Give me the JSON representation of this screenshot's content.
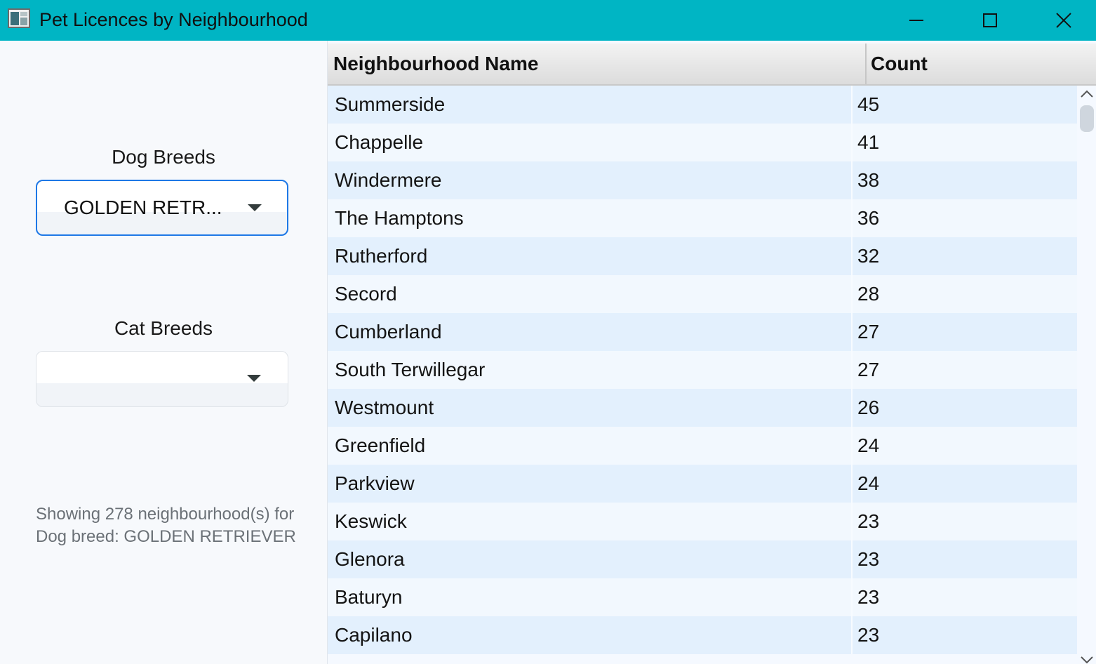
{
  "window": {
    "title": "Pet Licences by Neighbourhood"
  },
  "filters": {
    "dog_label": "Dog Breeds",
    "dog_selected": "GOLDEN RETR...",
    "cat_label": "Cat Breeds",
    "cat_selected": ""
  },
  "status": {
    "text": "Showing 278 neighbourhood(s) for Dog breed: GOLDEN RETRIEVER"
  },
  "table": {
    "columns": [
      "Neighbourhood Name",
      "Count"
    ],
    "rows": [
      {
        "name": "Summerside",
        "count": "45"
      },
      {
        "name": "Chappelle",
        "count": "41"
      },
      {
        "name": "Windermere",
        "count": "38"
      },
      {
        "name": "The Hamptons",
        "count": "36"
      },
      {
        "name": "Rutherford",
        "count": "32"
      },
      {
        "name": "Secord",
        "count": "28"
      },
      {
        "name": "Cumberland",
        "count": "27"
      },
      {
        "name": "South Terwillegar",
        "count": "27"
      },
      {
        "name": "Westmount",
        "count": "26"
      },
      {
        "name": "Greenfield",
        "count": "24"
      },
      {
        "name": "Parkview",
        "count": "24"
      },
      {
        "name": "Keswick",
        "count": "23"
      },
      {
        "name": "Glenora",
        "count": "23"
      },
      {
        "name": "Baturyn",
        "count": "23"
      },
      {
        "name": "Capilano",
        "count": "23"
      }
    ]
  },
  "icons": {
    "app": "app-window-icon",
    "minimize": "minimize-icon",
    "maximize": "maximize-icon",
    "close": "close-icon",
    "dropdown": "chevron-down-icon"
  },
  "colors": {
    "titlebar": "#00b5c4",
    "focus_border": "#1e78e6",
    "row_odd": "#e3f0fd",
    "row_even": "#f2f8fe"
  }
}
